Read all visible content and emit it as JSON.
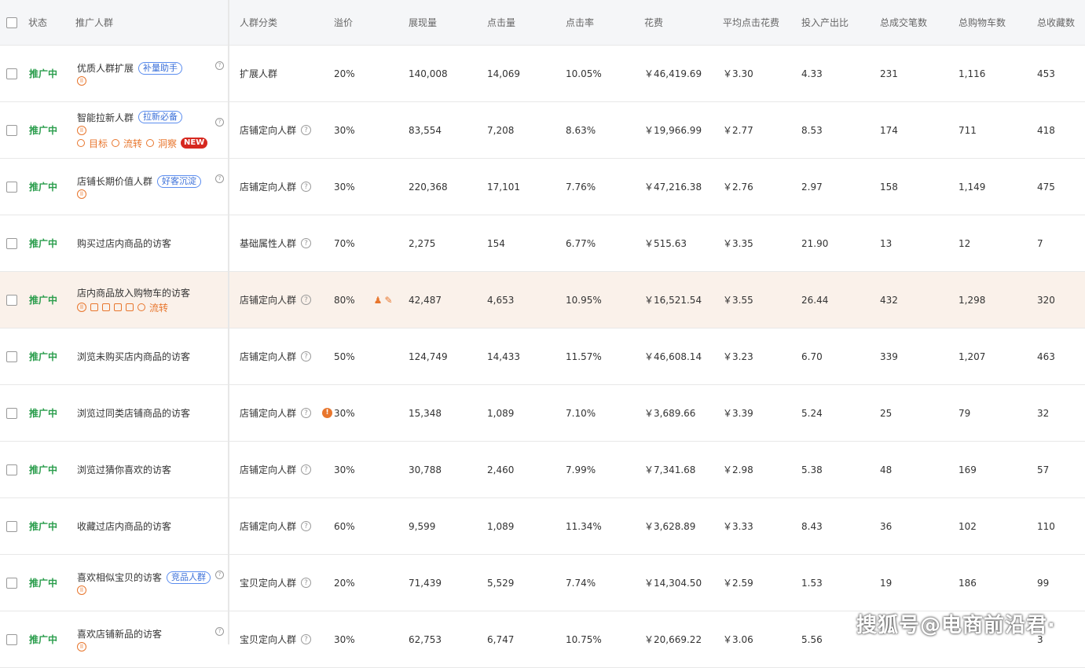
{
  "headers": {
    "status": "状态",
    "audience": "推广人群",
    "category": "人群分类",
    "premium": "溢价",
    "impressions": "展现量",
    "clicks": "点击量",
    "ctr": "点击率",
    "cost": "花费",
    "cpc": "平均点击花费",
    "roi": "投入产出比",
    "orders": "总成交笔数",
    "carts": "总购物车数",
    "favs": "总收藏数"
  },
  "rows": [
    {
      "status": "推广中",
      "name": "优质人群扩展",
      "tag": "补量助手",
      "category": "扩展人群",
      "premium": "20%",
      "impressions": "140,008",
      "clicks": "14,069",
      "ctr": "10.05%",
      "cost": "￥46,419.69",
      "cpc": "￥3.30",
      "roi": "4.33",
      "orders": "231",
      "carts": "1,116",
      "favs": "453"
    },
    {
      "status": "推广中",
      "name": "智能拉新人群",
      "tag": "拉新必备",
      "category": "店铺定向人群",
      "premium": "30%",
      "impressions": "83,554",
      "clicks": "7,208",
      "ctr": "8.63%",
      "cost": "￥19,966.99",
      "cpc": "￥2.77",
      "roi": "8.53",
      "orders": "174",
      "carts": "711",
      "favs": "418",
      "actions": {
        "target": "目标",
        "flow": "流转",
        "insight": "洞察",
        "badge": "NEW"
      }
    },
    {
      "status": "推广中",
      "name": "店铺长期价值人群",
      "tag": "好客沉淀",
      "category": "店铺定向人群",
      "premium": "30%",
      "impressions": "220,368",
      "clicks": "17,101",
      "ctr": "7.76%",
      "cost": "￥47,216.38",
      "cpc": "￥2.76",
      "roi": "2.97",
      "orders": "158",
      "carts": "1,149",
      "favs": "475"
    },
    {
      "status": "推广中",
      "name": "购买过店内商品的访客",
      "category": "基础属性人群",
      "premium": "70%",
      "impressions": "2,275",
      "clicks": "154",
      "ctr": "6.77%",
      "cost": "￥515.63",
      "cpc": "￥3.35",
      "roi": "21.90",
      "orders": "13",
      "carts": "12",
      "favs": "7"
    },
    {
      "status": "推广中",
      "name": "店内商品放入购物车的访客",
      "category": "店铺定向人群",
      "premium": "80%",
      "impressions": "42,487",
      "clicks": "4,653",
      "ctr": "10.95%",
      "cost": "￥16,521.54",
      "cpc": "￥3.55",
      "roi": "26.44",
      "orders": "432",
      "carts": "1,298",
      "favs": "320",
      "hover_flow": "流转"
    },
    {
      "status": "推广中",
      "name": "浏览未购买店内商品的访客",
      "category": "店铺定向人群",
      "premium": "50%",
      "impressions": "124,749",
      "clicks": "14,433",
      "ctr": "11.57%",
      "cost": "￥46,608.14",
      "cpc": "￥3.23",
      "roi": "6.70",
      "orders": "339",
      "carts": "1,207",
      "favs": "463"
    },
    {
      "status": "推广中",
      "name": "浏览过同类店铺商品的访客",
      "category": "店铺定向人群",
      "premium": "30%",
      "impressions": "15,348",
      "clicks": "1,089",
      "ctr": "7.10%",
      "cost": "￥3,689.66",
      "cpc": "￥3.39",
      "roi": "5.24",
      "orders": "25",
      "carts": "79",
      "favs": "32"
    },
    {
      "status": "推广中",
      "name": "浏览过猜你喜欢的访客",
      "category": "店铺定向人群",
      "premium": "30%",
      "impressions": "30,788",
      "clicks": "2,460",
      "ctr": "7.99%",
      "cost": "￥7,341.68",
      "cpc": "￥2.98",
      "roi": "5.38",
      "orders": "48",
      "carts": "169",
      "favs": "57"
    },
    {
      "status": "推广中",
      "name": "收藏过店内商品的访客",
      "category": "店铺定向人群",
      "premium": "60%",
      "impressions": "9,599",
      "clicks": "1,089",
      "ctr": "11.34%",
      "cost": "￥3,628.89",
      "cpc": "￥3.33",
      "roi": "8.43",
      "orders": "36",
      "carts": "102",
      "favs": "110"
    },
    {
      "status": "推广中",
      "name": "喜欢相似宝贝的访客",
      "tag": "竞品人群",
      "category": "宝贝定向人群",
      "premium": "20%",
      "impressions": "71,439",
      "clicks": "5,529",
      "ctr": "7.74%",
      "cost": "￥14,304.50",
      "cpc": "￥2.59",
      "roi": "1.53",
      "orders": "19",
      "carts": "186",
      "favs": "99"
    },
    {
      "status": "推广中",
      "name": "喜欢店铺新品的访客",
      "category": "宝贝定向人群",
      "premium": "30%",
      "impressions": "62,753",
      "clicks": "6,747",
      "ctr": "10.75%",
      "cost": "￥20,669.22",
      "cpc": "￥3.06",
      "roi": "5.56",
      "orders": "",
      "carts": "",
      "favs": "3"
    }
  ],
  "watermark": "搜狐号@电商前沿君·"
}
